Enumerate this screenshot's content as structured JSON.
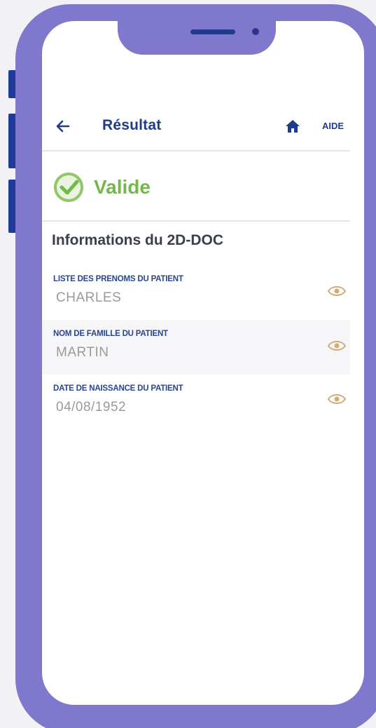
{
  "header": {
    "title": "Résultat",
    "help_label": "AIDE"
  },
  "status": {
    "label": "Valide",
    "color": "#74b84a"
  },
  "section": {
    "title": "Informations du 2D-DOC"
  },
  "fields": [
    {
      "label": "LISTE DES PRENOMS DU PATIENT",
      "value": "CHARLES"
    },
    {
      "label": "NOM DE FAMILLE DU PATIENT",
      "value": "MARTIN"
    },
    {
      "label": "DATE DE NAISSANCE DU PATIENT",
      "value": "04/08/1952"
    }
  ],
  "colors": {
    "frame": "#7f78cc",
    "accent": "#1f3b8c",
    "eye": "#d2ad78"
  },
  "icons": [
    "back-arrow-icon",
    "home-icon",
    "check-circle-icon",
    "eye-icon"
  ]
}
